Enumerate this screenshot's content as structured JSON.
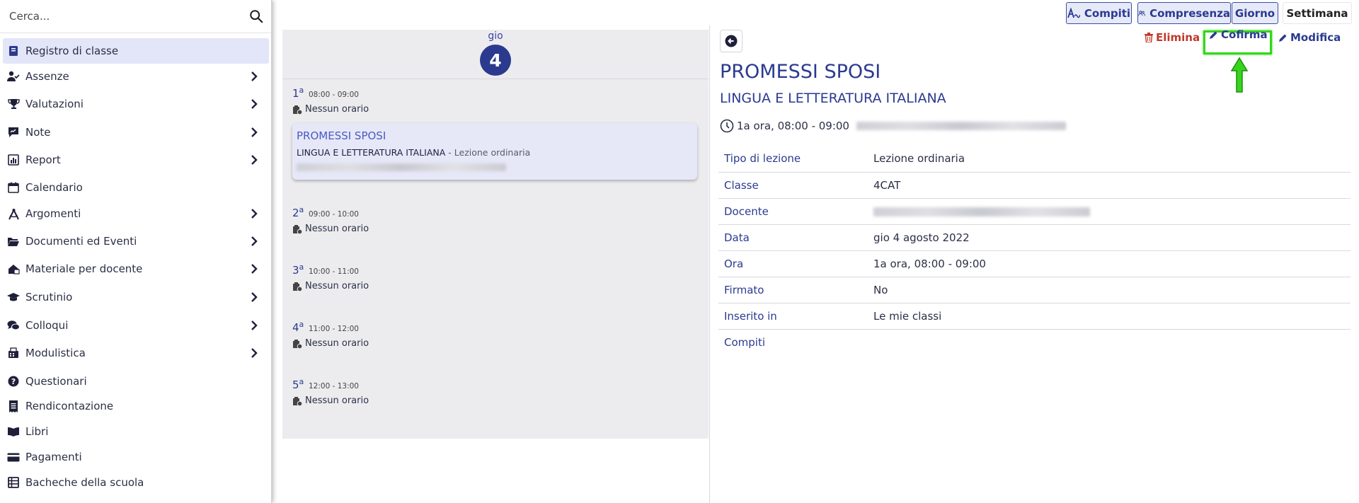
{
  "search": {
    "placeholder": "Cerca..."
  },
  "sidebar": {
    "items": [
      {
        "label": "Registro di classe",
        "icon": "book-icon",
        "active": true,
        "has_submenu": false
      },
      {
        "label": "Assenze",
        "icon": "user-check-icon",
        "has_submenu": true
      },
      {
        "label": "Valutazioni",
        "icon": "trophy-icon",
        "has_submenu": true
      },
      {
        "label": "Note",
        "icon": "note-icon",
        "has_submenu": true
      },
      {
        "label": "Report",
        "icon": "chart-icon",
        "has_submenu": true
      },
      {
        "label": "Calendario",
        "icon": "calendar-icon",
        "has_submenu": false
      },
      {
        "label": "Argomenti",
        "icon": "compass-icon",
        "has_submenu": true
      },
      {
        "label": "Documenti ed Eventi",
        "icon": "folder-open-icon",
        "has_submenu": true
      },
      {
        "label": "Materiale per docente",
        "icon": "house-book-icon",
        "has_submenu": true
      },
      {
        "label": "Scrutinio",
        "icon": "graduation-cap-icon",
        "has_submenu": true
      },
      {
        "label": "Colloqui",
        "icon": "chat-bubbles-icon",
        "has_submenu": true
      },
      {
        "label": "Modulistica",
        "icon": "fax-icon",
        "has_submenu": true
      },
      {
        "label": "Questionari",
        "icon": "question-circle-icon",
        "has_submenu": false
      },
      {
        "label": "Rendicontazione",
        "icon": "receipt-icon",
        "has_submenu": false
      },
      {
        "label": "Libri",
        "icon": "open-book-icon",
        "has_submenu": false
      },
      {
        "label": "Pagamenti",
        "icon": "credit-card-icon",
        "has_submenu": false
      },
      {
        "label": "Bacheche della scuola",
        "icon": "table-list-icon",
        "has_submenu": false
      }
    ]
  },
  "topbar": {
    "compiti": "Compiti",
    "compresenza": "Compresenza",
    "giorno": "Giorno",
    "settimana": "Settimana"
  },
  "day": {
    "name": "gio",
    "number": "4",
    "slots": [
      {
        "num": "1",
        "sup": "a",
        "time": "08:00 - 09:00",
        "status": "Nessun orario"
      },
      {
        "num": "2",
        "sup": "a",
        "time": "09:00 - 10:00",
        "status": "Nessun orario"
      },
      {
        "num": "3",
        "sup": "a",
        "time": "10:00 - 11:00",
        "status": "Nessun orario"
      },
      {
        "num": "4",
        "sup": "a",
        "time": "11:00 - 12:00",
        "status": "Nessun orario"
      },
      {
        "num": "5",
        "sup": "a",
        "time": "12:00 - 13:00",
        "status": "Nessun orario"
      }
    ],
    "lesson": {
      "title": "PROMESSI SPOSI",
      "subject": "LINGUA E LETTERATURA ITALIANA",
      "type": " - Lezione ordinaria"
    }
  },
  "detail": {
    "actions": {
      "elimina": "Elimina",
      "cofirma": "Cofirma",
      "modifica": "Modifica"
    },
    "title": "PROMESSI SPOSI",
    "subject": "LINGUA E LETTERATURA ITALIANA",
    "when": "1a ora, 08:00 - 09:00",
    "rows": [
      {
        "key": "Tipo di lezione",
        "value": "Lezione ordinaria"
      },
      {
        "key": "Classe",
        "value": "4CAT"
      },
      {
        "key": "Docente",
        "value": ""
      },
      {
        "key": "Data",
        "value": "gio 4 agosto 2022"
      },
      {
        "key": "Ora",
        "value": "1a ora, 08:00 - 09:00"
      },
      {
        "key": "Firmato",
        "value": "No"
      },
      {
        "key": "Inserito in",
        "value": "Le mie classi"
      },
      {
        "key": "Compiti",
        "value": ""
      }
    ],
    "highlight_color": "#35d51c"
  }
}
